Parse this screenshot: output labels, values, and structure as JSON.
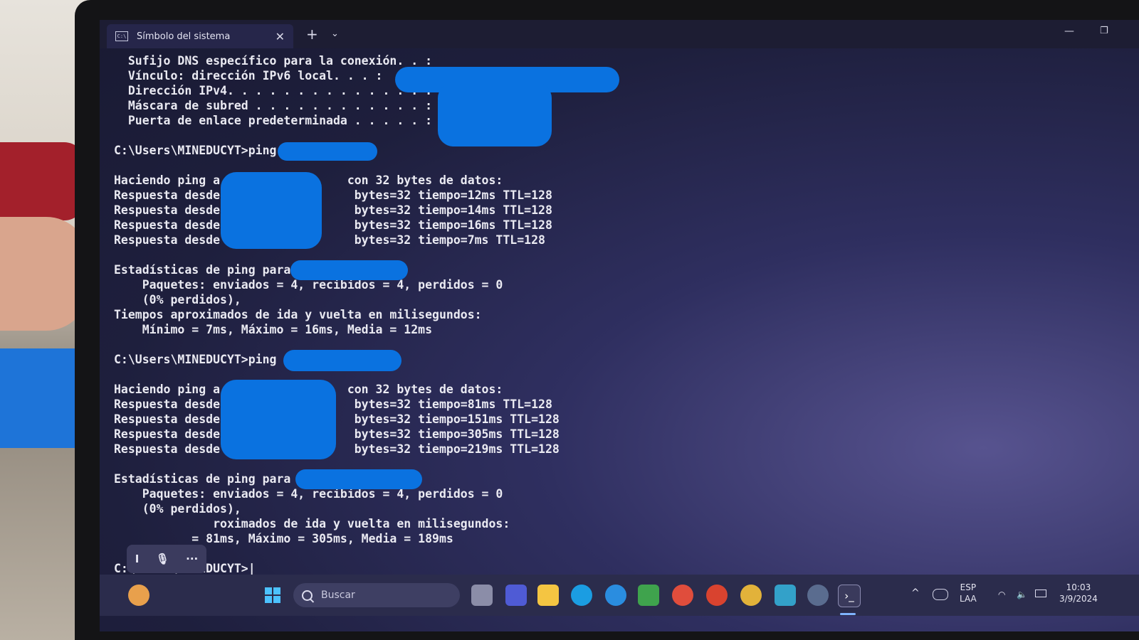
{
  "window": {
    "tab_title": "Símbolo del sistema",
    "tab_icon": "C:\\",
    "close_glyph": "✕",
    "new_tab_glyph": "+",
    "dropdown_glyph": "⌄",
    "minimize_glyph": "—",
    "restore_glyph": "❐"
  },
  "console": {
    "lines": [
      "  Sufijo DNS específico para la conexión. . :",
      "  Vínculo: dirección IPv6 local. . . :",
      "  Dirección IPv4. . . . . . . . . . . . . . :",
      "  Máscara de subred . . . . . . . . . . . . :",
      "  Puerta de enlace predeterminada . . . . . :",
      "C:\\Users\\MINEDUCYT>ping",
      "Haciendo ping a                  con 32 bytes de datos:",
      "Respuesta desde                   bytes=32 tiempo=12ms TTL=128",
      "Respuesta desde                   bytes=32 tiempo=14ms TTL=128",
      "Respuesta desde                   bytes=32 tiempo=16ms TTL=128",
      "Respuesta desde                   bytes=32 tiempo=7ms TTL=128",
      "Estadísticas de ping para",
      "    Paquetes: enviados = 4, recibidos = 4, perdidos = 0",
      "    (0% perdidos),",
      "Tiempos aproximados de ida y vuelta en milisegundos:",
      "    Mínimo = 7ms, Máximo = 16ms, Media = 12ms",
      "C:\\Users\\MINEDUCYT>ping",
      "Haciendo ping a                  con 32 bytes de datos:",
      "Respuesta desde                   bytes=32 tiempo=81ms TTL=128",
      "Respuesta desde                   bytes=32 tiempo=151ms TTL=128",
      "Respuesta desde                   bytes=32 tiempo=305ms TTL=128",
      "Respuesta desde                   bytes=32 tiempo=219ms TTL=128",
      "Estadísticas de ping para",
      "    Paquetes: enviados = 4, recibidos = 4, perdidos = 0",
      "    (0% perdidos),",
      "              roximados de ida y vuelta en milisegundos:",
      "           = 81ms, Máximo = 305ms, Media = 189ms",
      "C:\\Users\\MINEDUCYT>|"
    ]
  },
  "dictation": {
    "cursor_glyph": "I",
    "mic_glyph": "🎙",
    "more_glyph": "···"
  },
  "taskbar": {
    "search_placeholder": "Buscar",
    "tray": {
      "language": "ESP",
      "layout": "LAA",
      "time": "10:03",
      "date": "3/9/2024",
      "chevron_glyph": "^"
    }
  },
  "colors": {
    "redaction": "#0a72e0",
    "console_text": "#eaeaf2",
    "taskbar": "#2b2c4c"
  }
}
